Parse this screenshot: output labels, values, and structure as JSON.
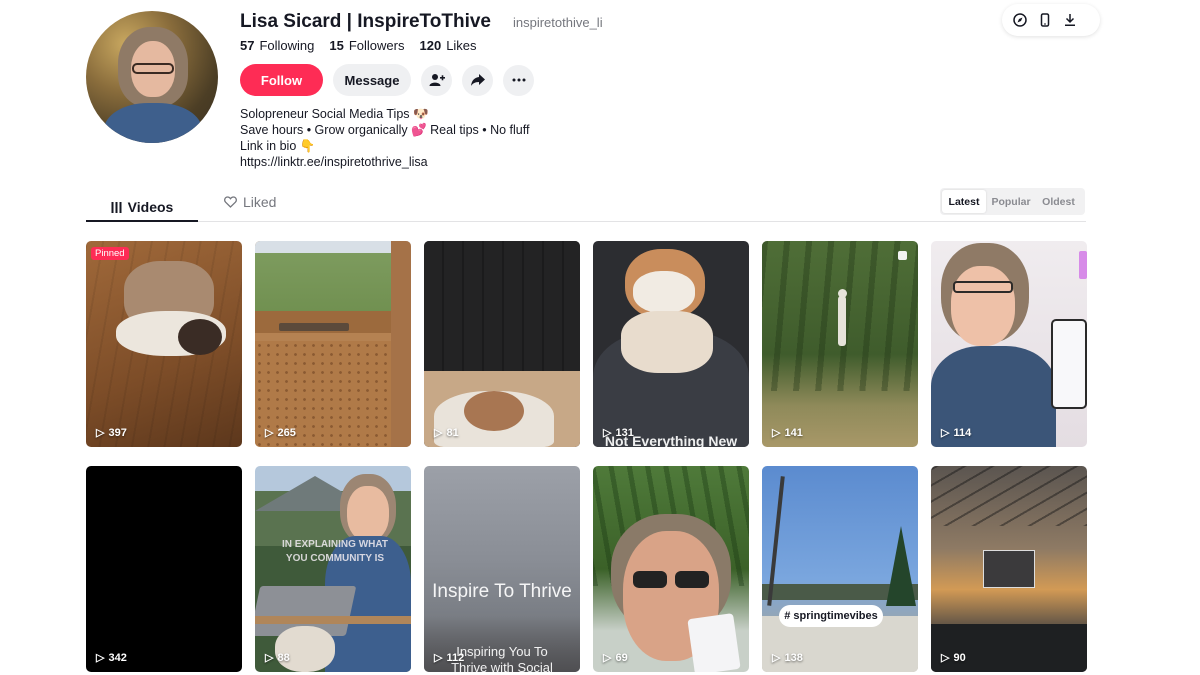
{
  "profile": {
    "display_name": "Lisa Sicard | InspireToThive",
    "username": "inspiretothive_li",
    "stats": {
      "following_count": "57",
      "following_label": "Following",
      "followers_count": "15",
      "followers_label": "Followers",
      "likes_count": "120",
      "likes_label": "Likes"
    },
    "follow_label": "Follow",
    "message_label": "Message",
    "bio": {
      "line1": "Solopreneur Social Media Tips 🐶",
      "line2": "Save hours • Grow organically 💕 Real tips • No fluff",
      "line3": "Link in bio 👇",
      "link": "https://linktr.ee/inspiretothrive_lisa"
    }
  },
  "tabs": {
    "videos": "Videos",
    "liked": "Liked"
  },
  "sort": {
    "latest": "Latest",
    "popular": "Popular",
    "oldest": "Oldest"
  },
  "videos": [
    {
      "views": "397",
      "badge": "Pinned"
    },
    {
      "views": "265"
    },
    {
      "views": "81"
    },
    {
      "views": "131",
      "overlay": "Not Everything New"
    },
    {
      "views": "141"
    },
    {
      "views": "114"
    },
    {
      "views": "342"
    },
    {
      "views": "88",
      "overlay": "IN EXPLAINING WHAT YOU COMMUNITY IS"
    },
    {
      "views": "112",
      "overlay": "Inspire To Thrive",
      "overlay2": "Inspiring You To Thrive with Social"
    },
    {
      "views": "69"
    },
    {
      "views": "138",
      "tag": "# springtimevibes"
    },
    {
      "views": "90"
    }
  ],
  "colors": {
    "accent": "#fe2c55",
    "text": "#161823",
    "muted": "#75777e"
  },
  "icons": [
    "add-friend-icon",
    "share-icon",
    "more-icon",
    "play-icon",
    "grid-icon",
    "heart-outline-icon",
    "compass-icon",
    "phone-icon",
    "download-icon"
  ]
}
